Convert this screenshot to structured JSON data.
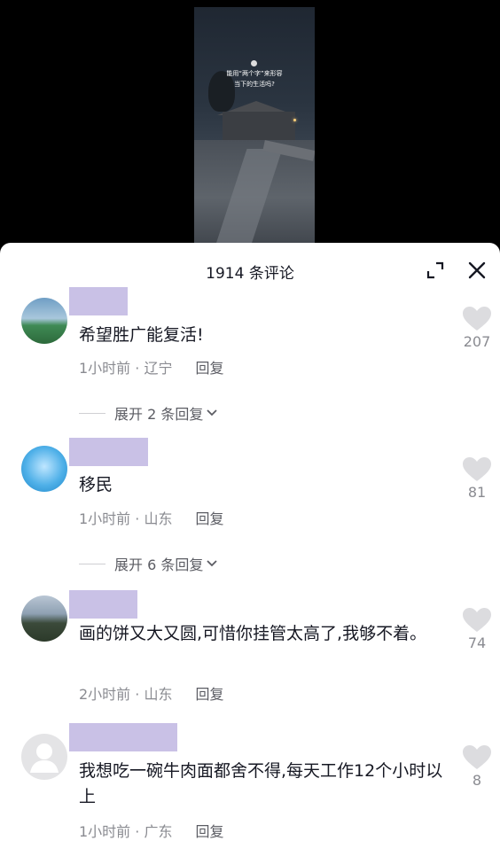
{
  "video": {
    "caption_line1": "能用“两个字”来形容",
    "caption_line2": "当下的生活吗?"
  },
  "header": {
    "title": "1914 条评论"
  },
  "comments": [
    {
      "text": "希望胜广能复活!",
      "time_location": "1小时前 · 辽宁",
      "reply_label": "回复",
      "likes": "207",
      "expand_label": "展开 2 条回复"
    },
    {
      "text": "移民",
      "time_location": "1小时前 · 山东",
      "reply_label": "回复",
      "likes": "81",
      "expand_label": "展开 6 条回复"
    },
    {
      "text": "画的饼又大又圆,可惜你挂管太高了,我够不着。",
      "time_location": "2小时前 · 山东",
      "reply_label": "回复",
      "likes": "74"
    },
    {
      "text": "我想吃一碗牛肉面都舍不得,每天工作12个小时以上",
      "time_location": "1小时前 · 广东",
      "reply_label": "回复",
      "likes": "8"
    }
  ],
  "colors": {
    "name_redaction": "#c9c1e6",
    "like_icon": "#dcdcdf",
    "text": "#161823",
    "meta": "#8a8b91"
  }
}
